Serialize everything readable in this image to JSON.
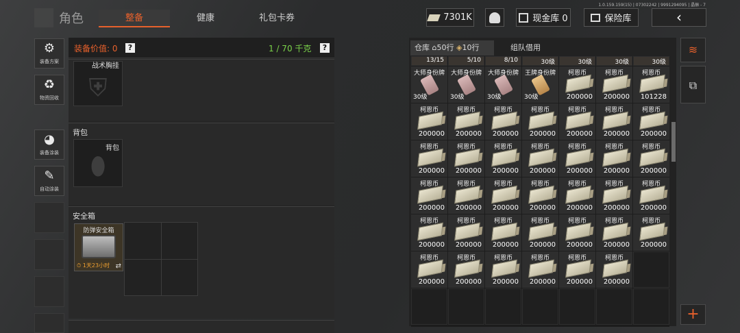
{
  "header": {
    "title": "角色",
    "tabs": [
      {
        "label": "整备",
        "active": true
      },
      {
        "label": "健康",
        "active": false
      },
      {
        "label": "礼包卡券",
        "active": false
      }
    ],
    "version": "1.0.159.159(15) | 07302242 | 9991294095 | 晶振 - 7",
    "currency_value": "7301K",
    "cash_vault_label": "现金库 0",
    "safe_vault_label": "保险库",
    "back_label": "‹"
  },
  "sidebar": {
    "items": [
      {
        "label": "装备方案",
        "icon": "wrench-gear-icon"
      },
      {
        "label": "物资回收",
        "icon": "recycle-icon"
      },
      {
        "label": "装备涂装",
        "icon": "helmet-icon"
      },
      {
        "label": "自动涂装",
        "icon": "brush-gear-icon"
      }
    ]
  },
  "equipment": {
    "value_label": "装备价值: 0",
    "weight_label": "1 / 70 千克",
    "help": "?",
    "tactical_label": "战术胸挂",
    "backpack_section": "背包",
    "backpack_slot": "背包",
    "safe_section": "安全箱",
    "safe_name": "防弹安全箱",
    "safe_timer": "1天23小时",
    "swap_icon": "⇄"
  },
  "warehouse": {
    "tab_label": "仓库",
    "rows_label": "50行",
    "tickets_label": "10行",
    "team_tab": "组队借用",
    "top_row": [
      "13/15",
      "5/10",
      "8/10",
      "30级",
      "30级",
      "30级",
      "30级"
    ],
    "id_cards": [
      {
        "name": "大师身份牌",
        "level": "30级",
        "color": "pink"
      },
      {
        "name": "大师身份牌",
        "level": "30级",
        "color": "pink"
      },
      {
        "name": "大师身份牌",
        "level": "30级",
        "color": "pink"
      },
      {
        "name": "王牌身份牌",
        "level": "30级",
        "color": "gold"
      }
    ],
    "currency_name": "柯恩币",
    "currency_amounts_row1": [
      "200000",
      "200000",
      "101228"
    ],
    "currency_amount": "200000"
  },
  "colors": {
    "accent": "#e8612c",
    "value_red": "#e8612c",
    "weight_green": "#7bd34a"
  }
}
